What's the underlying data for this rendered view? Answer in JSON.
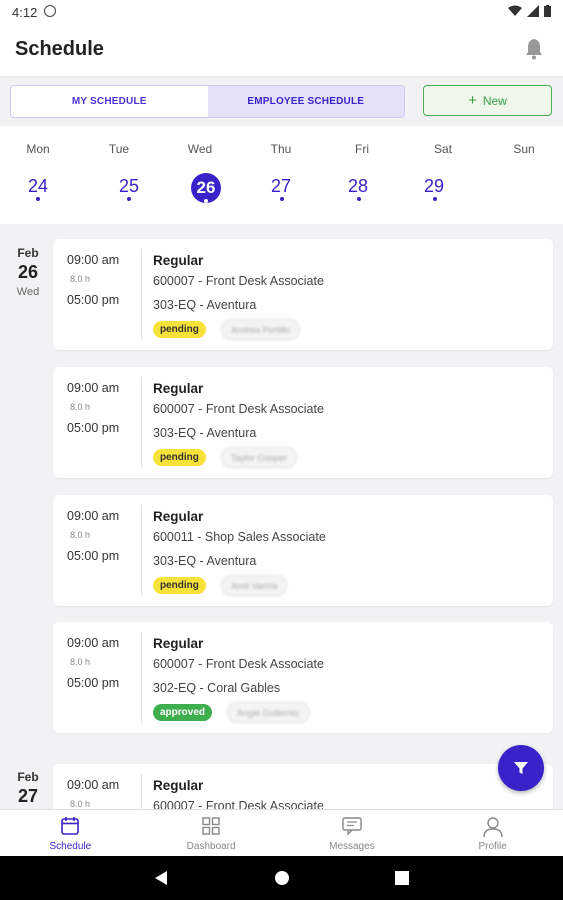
{
  "status_bar": {
    "time": "4:12"
  },
  "header": {
    "title": "Schedule"
  },
  "tabs": [
    {
      "label": "MY SCHEDULE",
      "active": false
    },
    {
      "label": "EMPLOYEE SCHEDULE",
      "active": true
    }
  ],
  "new_button": {
    "icon": "+",
    "label": "New"
  },
  "week": {
    "days": [
      {
        "name": "Mon",
        "num": "24"
      },
      {
        "name": "Tue",
        "num": "25"
      },
      {
        "name": "Wed",
        "num": "26",
        "selected": true
      },
      {
        "name": "Thu",
        "num": "27"
      },
      {
        "name": "Fri",
        "num": "28"
      },
      {
        "name": "Sat",
        "num": "29"
      },
      {
        "name": "Sun",
        "num": ""
      }
    ]
  },
  "groups": [
    {
      "month": "Feb",
      "day": "26",
      "weekday": "Wed",
      "shifts": [
        {
          "start": "09:00 am",
          "duration": "8.0 h",
          "end": "05:00 pm",
          "type": "Regular",
          "position": "600007 - Front Desk Associate",
          "location": "303-EQ - Aventura",
          "status": "pending",
          "assignee": "Andrea Portillo"
        },
        {
          "start": "09:00 am",
          "duration": "8.0 h",
          "end": "05:00 pm",
          "type": "Regular",
          "position": "600007 - Front Desk Associate",
          "location": "303-EQ - Aventura",
          "status": "pending",
          "assignee": "Taylor Cooper"
        },
        {
          "start": "09:00 am",
          "duration": "8.0 h",
          "end": "05:00 pm",
          "type": "Regular",
          "position": "600011 - Shop Sales Associate",
          "location": "303-EQ - Aventura",
          "status": "pending",
          "assignee": "Amit Varma"
        },
        {
          "start": "09:00 am",
          "duration": "8.0 h",
          "end": "05:00 pm",
          "type": "Regular",
          "position": "600007 - Front Desk Associate",
          "location": "302-EQ - Coral Gables",
          "status": "approved",
          "assignee": "Angie Gutierrez"
        }
      ]
    },
    {
      "month": "Feb",
      "day": "27",
      "weekday": "",
      "shifts": [
        {
          "start": "09:00 am",
          "duration": "8.0 h",
          "end": "",
          "type": "Regular",
          "position": "600007 - Front Desk Associate",
          "location": "",
          "status": "",
          "assignee": ""
        }
      ]
    }
  ],
  "bottom_nav": [
    {
      "label": "Schedule",
      "icon": "calendar-icon",
      "active": true
    },
    {
      "label": "Dashboard",
      "icon": "dashboard-icon",
      "active": false
    },
    {
      "label": "Messages",
      "icon": "messages-icon",
      "active": false
    },
    {
      "label": "Profile",
      "icon": "profile-icon",
      "active": false
    }
  ],
  "colors": {
    "accent": "#3a22c9",
    "pending": "#f7e23a",
    "approved": "#3fae4c",
    "new_button": "#4caf50"
  }
}
